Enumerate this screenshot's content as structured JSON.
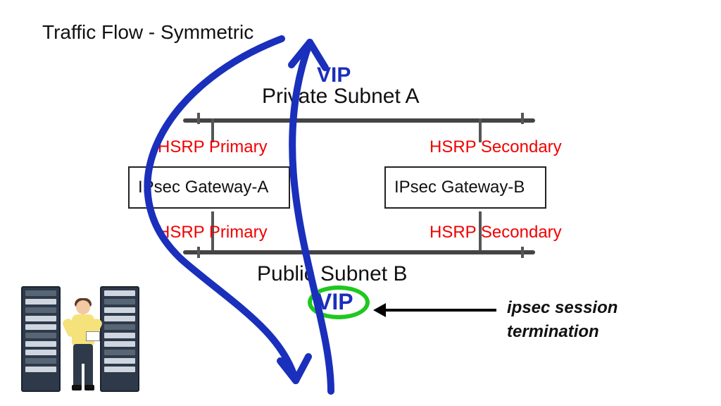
{
  "title": "Traffic Flow - Symmetric",
  "vip_label_top": "VIP",
  "vip_label_bottom": "VIP",
  "subnet_a": "Private Subnet A",
  "subnet_b": "Public Subnet B",
  "gateways": {
    "a": {
      "name": "IPsec Gateway-A",
      "upper_role": "HSRP Primary",
      "lower_role": "HSRP Primary"
    },
    "b": {
      "name": "IPsec Gateway-B",
      "upper_role": "HSRP Secondary",
      "lower_role": "HSRP Secondary"
    }
  },
  "annotation": {
    "line1": "ipsec session",
    "line2": "termination"
  },
  "flow_color": "#1a2fbb",
  "hsrp_color": "#f20000",
  "vip_circle_color": "#1ec81e"
}
